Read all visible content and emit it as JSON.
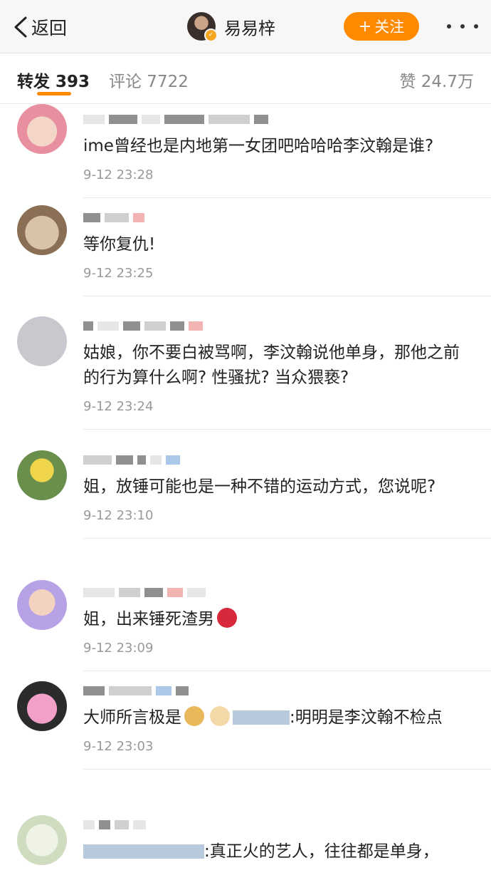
{
  "header": {
    "back_label": "返回",
    "title": "易易梓",
    "follow_label": "关注",
    "follow_plus": "+",
    "more_icon": "more-dots-icon",
    "accent": "#ff8a00"
  },
  "tabs": {
    "repost": "转发 393",
    "comment": "评论 7722",
    "like": "赞 24.7万"
  },
  "items": [
    {
      "text": "ime曾经也是内地第一女团吧哈哈哈李汶翰是谁?",
      "time": "9-12 23:28"
    },
    {
      "text": "等你复仇!",
      "time": "9-12 23:25"
    },
    {
      "text_a": "姑娘，你不要白被骂啊，李汶翰说他单身，那他之前的行为算什么啊? 性骚扰? 当众猥亵?",
      "time": "9-12 23:24"
    },
    {
      "text": "姐，放锤可能也是一种不错的运动方式，您说呢?",
      "time": "9-12 23:10"
    },
    {
      "text": "姐，出来锤死渣男",
      "time": "9-12 23:09"
    },
    {
      "prefix": "大师所言极是",
      "text_b": ":明明是李汶翰不检点",
      "time": "9-12 23:03"
    },
    {
      "text_c": ":真正火的艺人，往往都是单身，",
      "time": ""
    }
  ]
}
